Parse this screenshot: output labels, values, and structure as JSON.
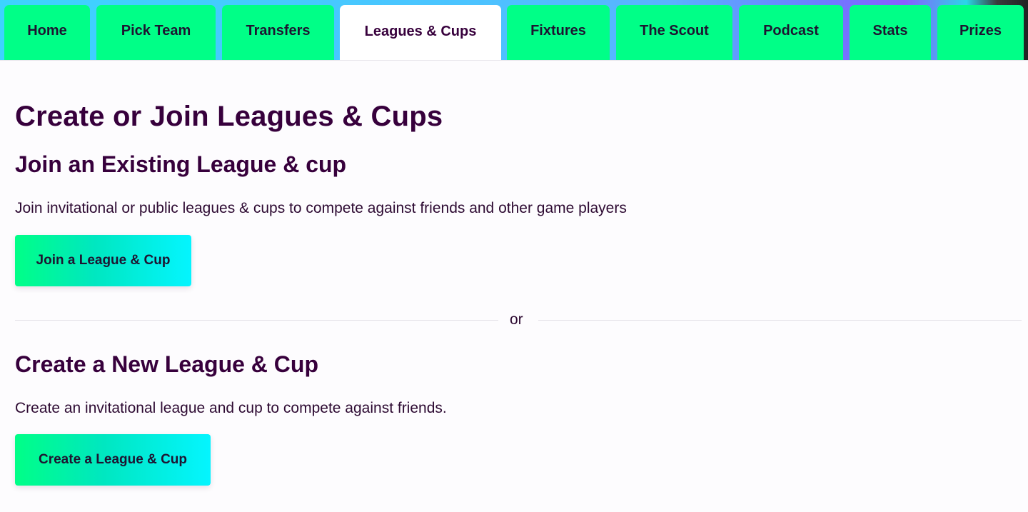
{
  "nav": {
    "tabs": [
      {
        "label": "Home",
        "active": false
      },
      {
        "label": "Pick Team",
        "active": false
      },
      {
        "label": "Transfers",
        "active": false
      },
      {
        "label": "Leagues & Cups",
        "active": true
      },
      {
        "label": "Fixtures",
        "active": false
      },
      {
        "label": "The Scout",
        "active": false
      },
      {
        "label": "Podcast",
        "active": false
      },
      {
        "label": "Stats",
        "active": false
      },
      {
        "label": "Prizes",
        "active": false
      }
    ]
  },
  "page": {
    "title": "Create or Join Leagues & Cups",
    "join_section": {
      "heading": "Join an Existing League & cup",
      "description": "Join invitational or public leagues & cups to compete against friends and other game players",
      "button_label": "Join a League & Cup"
    },
    "divider_label": "or",
    "create_section": {
      "heading": "Create a New League & Cup",
      "description": "Create an invitational league and cup to compete against friends.",
      "button_label": "Create a League & Cup"
    }
  },
  "colors": {
    "brand_purple": "#37003c",
    "tab_green": "#00ff87",
    "button_gradient_start": "#00ff87",
    "button_gradient_end": "#04f5ff",
    "nav_background": "#3dd3ff"
  }
}
